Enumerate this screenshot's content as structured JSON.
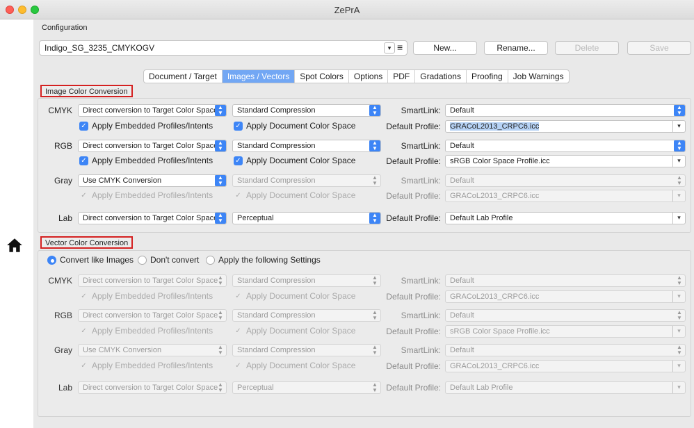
{
  "window": {
    "title": "ZePrA"
  },
  "config": {
    "section_label": "Configuration",
    "selected": "Indigo_SG_3235_CMYKOGV",
    "buttons": {
      "new": "New...",
      "rename": "Rename...",
      "delete": "Delete",
      "save": "Save"
    }
  },
  "tabs": [
    "Document / Target",
    "Images / Vectors",
    "Spot Colors",
    "Options",
    "PDF",
    "Gradations",
    "Proofing",
    "Job Warnings"
  ],
  "active_tab": "Images / Vectors",
  "image": {
    "title": "Image Color Conversion",
    "smartlink_label": "SmartLink:",
    "default_profile_label": "Default Profile:",
    "rows": [
      {
        "label": "CMYK",
        "method": "Direct conversion to Target Color Space",
        "compression": "Standard Compression",
        "smartlink": "Default",
        "apply_embedded": "Apply Embedded Profiles/Intents",
        "apply_document": "Apply Document Color Space",
        "profile": "GRACoL2013_CRPC6.icc"
      },
      {
        "label": "RGB",
        "method": "Direct conversion to Target Color Space",
        "compression": "Standard Compression",
        "smartlink": "Default",
        "apply_embedded": "Apply Embedded Profiles/Intents",
        "apply_document": "Apply Document Color Space",
        "profile": "sRGB Color Space Profile.icc"
      },
      {
        "label": "Gray",
        "method": "Use CMYK Conversion",
        "compression": "Standard Compression",
        "smartlink": "Default",
        "apply_embedded": "Apply Embedded Profiles/Intents",
        "apply_document": "Apply Document Color Space",
        "profile": "GRACoL2013_CRPC6.icc"
      },
      {
        "label": "Lab",
        "method": "Direct conversion to Target Color Space",
        "compression": "Perceptual",
        "profile": "Default Lab Profile"
      }
    ]
  },
  "vector": {
    "title": "Vector Color Conversion",
    "radios": [
      "Convert like Images",
      "Don't convert",
      "Apply the following Settings"
    ],
    "selected_radio": "Convert like Images",
    "smartlink_label": "SmartLink:",
    "default_profile_label": "Default Profile:",
    "rows": [
      {
        "label": "CMYK",
        "method": "Direct conversion to Target Color Space",
        "compression": "Standard Compression",
        "smartlink": "Default",
        "apply_embedded": "Apply Embedded Profiles/Intents",
        "apply_document": "Apply Document Color Space",
        "profile": "GRACoL2013_CRPC6.icc"
      },
      {
        "label": "RGB",
        "method": "Direct conversion to Target Color Space",
        "compression": "Standard Compression",
        "smartlink": "Default",
        "apply_embedded": "Apply Embedded Profiles/Intents",
        "apply_document": "Apply Document Color Space",
        "profile": "sRGB Color Space Profile.icc"
      },
      {
        "label": "Gray",
        "method": "Use CMYK Conversion",
        "compression": "Standard Compression",
        "smartlink": "Default",
        "apply_embedded": "Apply Embedded Profiles/Intents",
        "apply_document": "Apply Document Color Space",
        "profile": "GRACoL2013_CRPC6.icc"
      },
      {
        "label": "Lab",
        "method": "Direct conversion to Target Color Space",
        "compression": "Perceptual",
        "profile": "Default Lab Profile"
      }
    ]
  },
  "icons": {
    "home": "home-icon",
    "list": "list-icon"
  },
  "colors": {
    "accent": "#3d85f6",
    "active_tab": "#72a7f4",
    "highlight_border": "#d42020"
  }
}
